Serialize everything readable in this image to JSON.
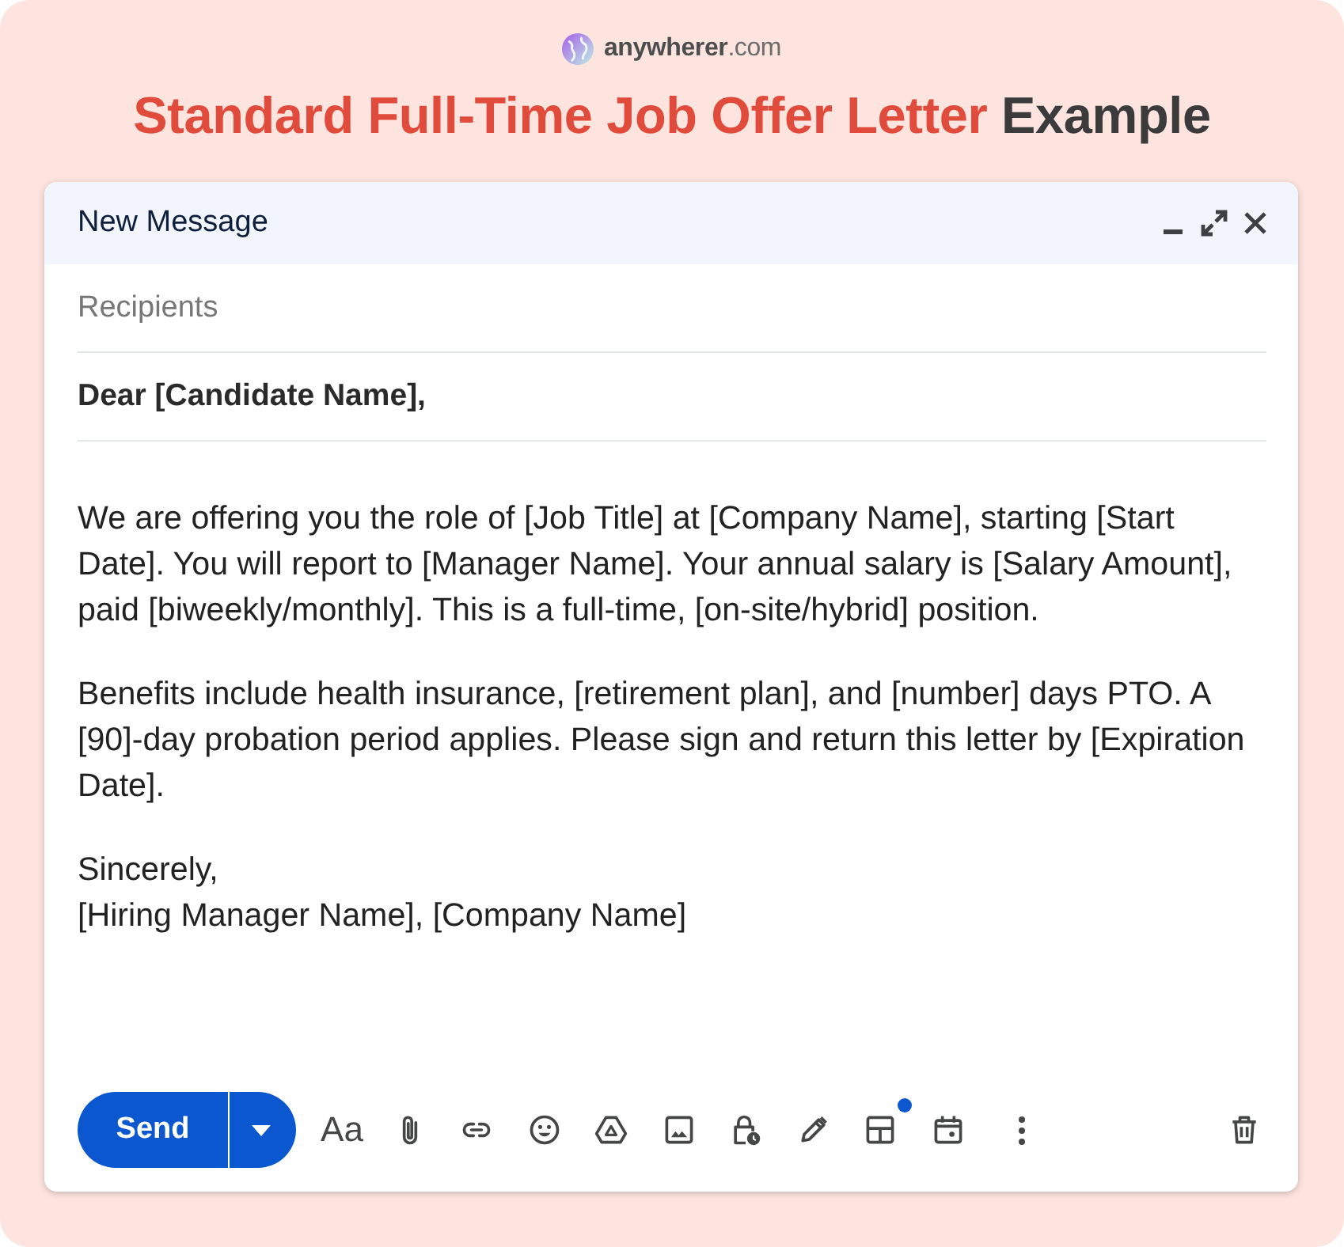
{
  "logo": {
    "text": "**anywherer**.com"
  },
  "headline": {
    "highlight": "Standard Full-Time Job Offer Letter",
    "rest": "Example"
  },
  "compose": {
    "title": "New Message",
    "recipients": {
      "placeholder": "Recipients"
    },
    "subject": {
      "value": "Dear [Candidate Name],"
    },
    "body": {
      "paragraphs": [
        "We are offering you the role of [Job Title] at [Company Name], starting [Start Date]. You will report to [Manager Name]. Your annual salary is [Salary Amount], paid [biweekly/monthly]. This is a full-time, [on-site/hybrid] position.",
        "Benefits include health insurance, [retirement plan], and [number] days PTO. A [90]-day probation period applies. Please sign and return this letter by [Expiration Date]."
      ],
      "closing": [
        "Sincerely,",
        "[Hiring Manager Name], [Company Name]"
      ]
    },
    "toolbar": {
      "send": "Send",
      "format": "Aa",
      "layouts_new": true
    }
  }
}
